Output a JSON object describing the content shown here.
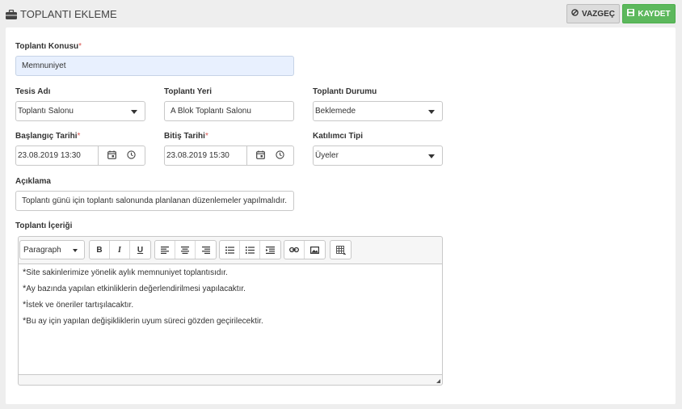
{
  "header": {
    "title": "TOPLANTI EKLEME",
    "cancel_label": "VAZGEÇ",
    "save_label": "KAYDET"
  },
  "form": {
    "subject": {
      "label": "Toplantı Konusu",
      "required_mark": "*",
      "value": "Memnuniyet"
    },
    "facility": {
      "label": "Tesis Adı",
      "value": "Toplantı Salonu"
    },
    "location": {
      "label": "Toplantı Yeri",
      "value": "A Blok Toplantı Salonu"
    },
    "status": {
      "label": "Toplantı Durumu",
      "value": "Beklemede"
    },
    "start_date": {
      "label": "Başlangıç Tarihi",
      "required_mark": "*",
      "value": "23.08.2019 13:30"
    },
    "end_date": {
      "label": "Bitiş Tarihi",
      "required_mark": "*",
      "value": "23.08.2019 15:30"
    },
    "participant_type": {
      "label": "Katılımcı Tipi",
      "value": "Üyeler"
    },
    "description": {
      "label": "Açıklama",
      "value": "Toplantı günü için toplantı salonunda planlanan düzenlemeler yapılmalıdır."
    },
    "content": {
      "label": "Toplantı İçeriği",
      "format_select": "Paragraph",
      "toolbar": {
        "bold": "B",
        "italic": "I",
        "underline": "U"
      },
      "lines": [
        "Site sakinlerimize yönelik aylık memnuniyet toplantısıdır.",
        "Ay bazında yapılan etkinliklerin değerlendirilmesi yapılacaktır.",
        "İstek ve öneriler tartışılacaktır.",
        "Bu ay için yapılan değişikliklerin uyum süreci gözden geçirilecektir."
      ]
    }
  },
  "icons": {
    "title": "briefcase-icon",
    "cancel": "ban-icon",
    "save": "floppy-disk-icon",
    "date": "calendar-icon",
    "time": "clock-icon"
  },
  "colors": {
    "save_button": "#5cb85c",
    "required": "#d9534f",
    "subject_field_bg": "#e8f0fe"
  }
}
